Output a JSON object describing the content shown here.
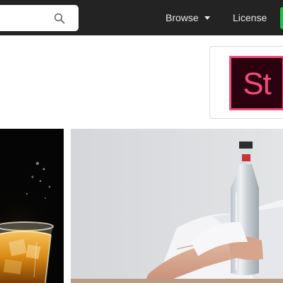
{
  "header": {
    "search": {
      "placeholder": "",
      "value": "",
      "icon": "search-icon"
    },
    "nav": {
      "browse_label": "Browse",
      "browse_icon": "caret-down-icon",
      "license_label": "License"
    },
    "cta_color": "#2eb84b"
  },
  "logo": {
    "text": "St",
    "background": "#2b000f",
    "accent": "#ef4d7b"
  },
  "colors": {
    "topbar": "#232323",
    "page_background": "#ffffff"
  }
}
